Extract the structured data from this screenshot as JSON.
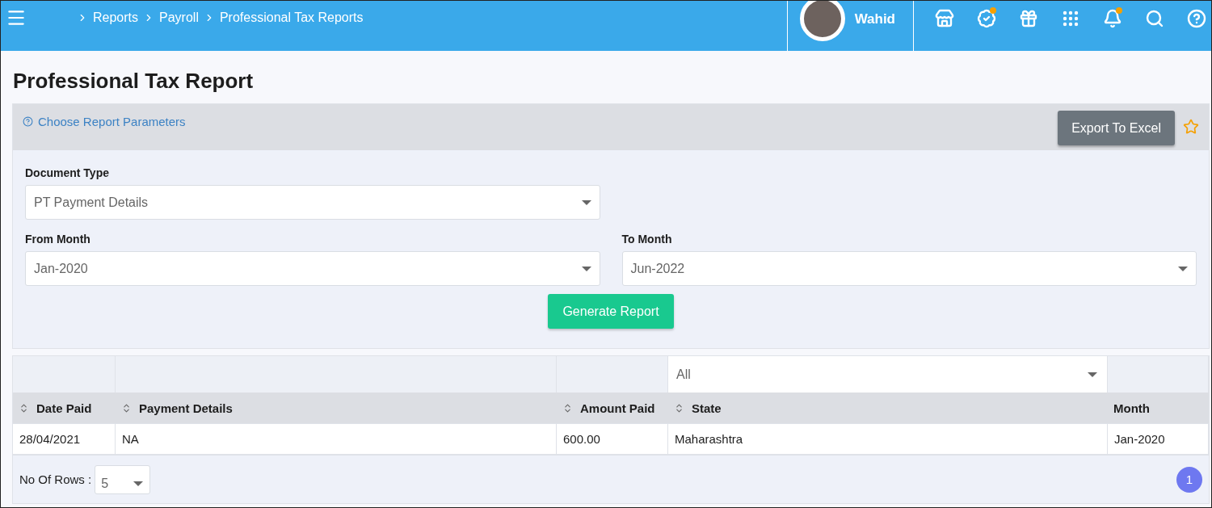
{
  "header": {
    "breadcrumbs": [
      "Reports",
      "Payroll",
      "Professional Tax Reports"
    ],
    "user": {
      "name": "Wahid"
    },
    "toolbar": [
      {
        "kind": "store",
        "dot": false
      },
      {
        "kind": "badge",
        "dot": true
      },
      {
        "kind": "gift",
        "dot": false
      },
      {
        "kind": "apps",
        "dot": false
      },
      {
        "kind": "bell",
        "dot": true
      },
      {
        "kind": "search",
        "dot": false
      },
      {
        "kind": "help",
        "dot": false
      }
    ]
  },
  "title": "Professional Tax Report",
  "params": {
    "link": "Choose Report Parameters",
    "export_button": "Export To Excel",
    "favorite": false,
    "fields": [
      {
        "label": "Document Type",
        "value": "PT Payment Details"
      },
      {
        "label": "From Month",
        "value": "Jan-2020"
      },
      {
        "label": "To Month",
        "value": "Jun-2022"
      }
    ],
    "generate_button": "Generate Report"
  },
  "table": {
    "state_filter": "All",
    "columns": [
      {
        "label": "Date Paid",
        "sortable": true
      },
      {
        "label": "Payment Details",
        "sortable": true
      },
      {
        "label": "Amount Paid",
        "sortable": true
      },
      {
        "label": "State",
        "sortable": true
      },
      {
        "label": "Month",
        "sortable": false
      }
    ],
    "rows": [
      [
        "28/04/2021",
        "NA",
        "600.00",
        "Maharashtra",
        "Jan-2020"
      ]
    ]
  },
  "footer": {
    "rows_label": "No Of Rows :",
    "rows_value": "5",
    "pages": [
      {
        "label": "1",
        "selected": true
      }
    ]
  }
}
